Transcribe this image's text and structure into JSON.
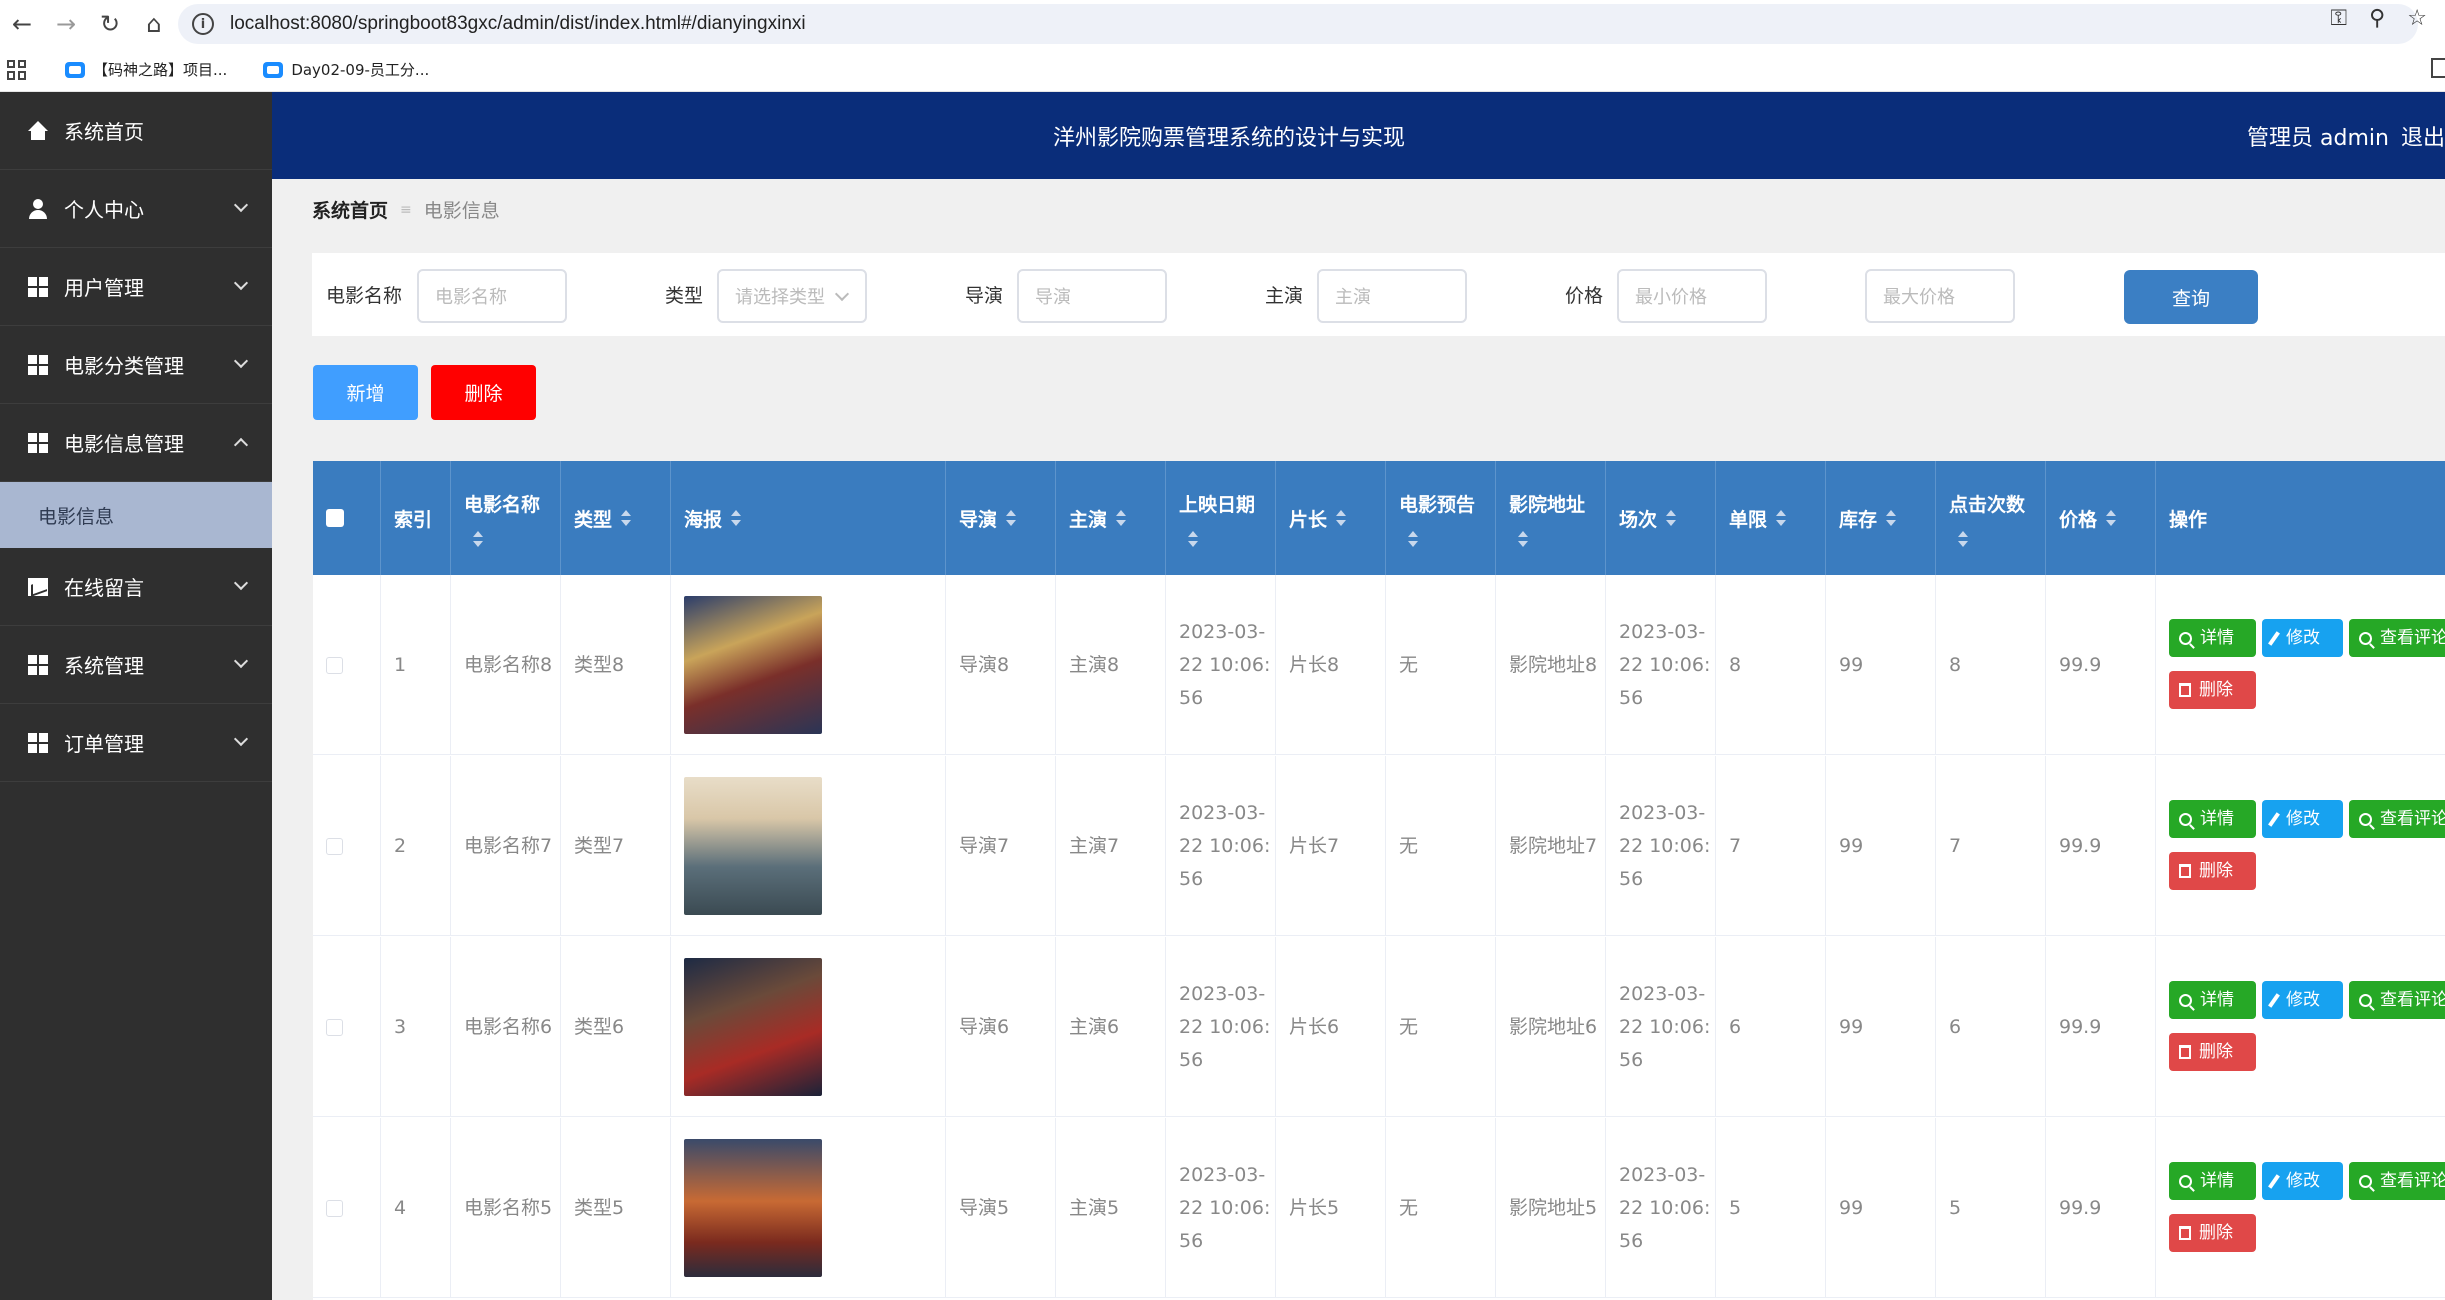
{
  "browser": {
    "url": "localhost:8080/springboot83gxc/admin/dist/index.html#/dianyingxinxi",
    "bookmarks": [
      "【码神之路】项目...",
      "Day02-09-员工分..."
    ]
  },
  "header": {
    "title": "洋州影院购票管理系统的设计与实现",
    "admin_label": "管理员 admin",
    "logout_label": "退出"
  },
  "sidebar": {
    "items": [
      {
        "label": "系统首页",
        "icon": "home-icon"
      },
      {
        "label": "个人中心",
        "icon": "user-icon"
      },
      {
        "label": "用户管理",
        "icon": "grid-icon"
      },
      {
        "label": "电影分类管理",
        "icon": "grid-icon"
      },
      {
        "label": "电影信息管理",
        "icon": "grid-icon"
      },
      {
        "label": "在线留言",
        "icon": "chart-icon"
      },
      {
        "label": "系统管理",
        "icon": "grid-icon"
      },
      {
        "label": "订单管理",
        "icon": "grid-icon"
      }
    ],
    "active_sub": "电影信息"
  },
  "breadcrumb": {
    "home": "系统首页",
    "current": "电影信息"
  },
  "search": {
    "name_label": "电影名称",
    "name_placeholder": "电影名称",
    "type_label": "类型",
    "type_placeholder": "请选择类型",
    "director_label": "导演",
    "director_placeholder": "导演",
    "actor_label": "主演",
    "actor_placeholder": "主演",
    "price_label": "价格",
    "min_placeholder": "最小价格",
    "max_placeholder": "最大价格",
    "query_label": "查询"
  },
  "toolbar": {
    "add_label": "新增",
    "delete_label": "删除"
  },
  "table": {
    "headers": {
      "index": "索引",
      "name1": "电影名称",
      "type": "类型",
      "poster": "海报",
      "director": "导演",
      "actor": "主演",
      "date1": "上映日期",
      "length": "片长",
      "trailer1": "电影预告",
      "address1": "影院地址",
      "session": "场次",
      "limit": "单限",
      "stock": "库存",
      "clicks1": "点击次数",
      "price": "价格",
      "ops": "操作"
    },
    "actions": {
      "detail": "详情",
      "edit": "修改",
      "comment": "查看评论",
      "remove": "删除"
    },
    "rows": [
      {
        "index": "1",
        "name": "电影名称8",
        "type": "类型8",
        "director": "导演8",
        "actor": "主演8",
        "date": "2023-03-22 10:06:56",
        "length": "片长8",
        "trailer": "无",
        "address": "影院地址8",
        "session": "2023-03-22 10:06:56",
        "limit": "8",
        "stock": "99",
        "clicks": "8",
        "price": "99.9"
      },
      {
        "index": "2",
        "name": "电影名称7",
        "type": "类型7",
        "director": "导演7",
        "actor": "主演7",
        "date": "2023-03-22 10:06:56",
        "length": "片长7",
        "trailer": "无",
        "address": "影院地址7",
        "session": "2023-03-22 10:06:56",
        "limit": "7",
        "stock": "99",
        "clicks": "7",
        "price": "99.9"
      },
      {
        "index": "3",
        "name": "电影名称6",
        "type": "类型6",
        "director": "导演6",
        "actor": "主演6",
        "date": "2023-03-22 10:06:56",
        "length": "片长6",
        "trailer": "无",
        "address": "影院地址6",
        "session": "2023-03-22 10:06:56",
        "limit": "6",
        "stock": "99",
        "clicks": "6",
        "price": "99.9"
      },
      {
        "index": "4",
        "name": "电影名称5",
        "type": "类型5",
        "director": "导演5",
        "actor": "主演5",
        "date": "2023-03-22 10:06:56",
        "length": "片长5",
        "trailer": "无",
        "address": "影院地址5",
        "session": "2023-03-22 10:06:56",
        "limit": "5",
        "stock": "99",
        "clicks": "5",
        "price": "99.9"
      }
    ]
  },
  "colors": {
    "topbar": "#0a2d7a",
    "sidebar": "#2f2f2f",
    "thead": "#3a7cbf",
    "add": "#409eff",
    "delete": "#ff0000",
    "query": "#3b7fc4"
  }
}
